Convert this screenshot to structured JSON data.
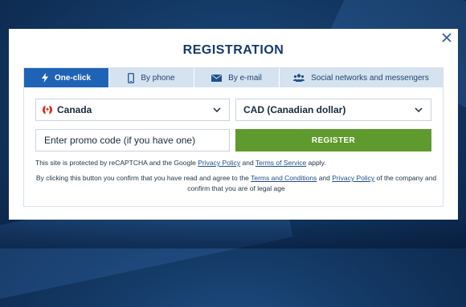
{
  "modal": {
    "title": "REGISTRATION",
    "close_icon": "close-icon"
  },
  "tabs": [
    {
      "label": "One-click",
      "icon": "lightning-icon",
      "active": true
    },
    {
      "label": "By phone",
      "icon": "phone-icon",
      "active": false
    },
    {
      "label": "By e-mail",
      "icon": "envelope-icon",
      "active": false
    },
    {
      "label": "Social networks and messengers",
      "icon": "users-icon",
      "active": false
    }
  ],
  "form": {
    "country": "Canada",
    "currency": "CAD (Canadian dollar)",
    "promo_placeholder": "Enter promo code (if you have one)",
    "register_label": "REGISTER"
  },
  "recaptcha": {
    "text_1": "This site is protected by reCAPTCHA and the Google ",
    "privacy_link": "Privacy Policy",
    "text_2": " and ",
    "terms_link": "Terms of Service",
    "text_3": " apply."
  },
  "consent": {
    "text_1": "By clicking this button you confirm that you have read and agree to the ",
    "terms_link": "Terms and Conditions",
    "text_2": " and ",
    "privacy_link": "Privacy Policy",
    "text_3": " of the company and confirm that you are of legal age"
  },
  "colors": {
    "accent": "#1f63b6",
    "register": "#5e9a2d",
    "title": "#143a6c",
    "tab_bg": "#d5e2f0"
  }
}
